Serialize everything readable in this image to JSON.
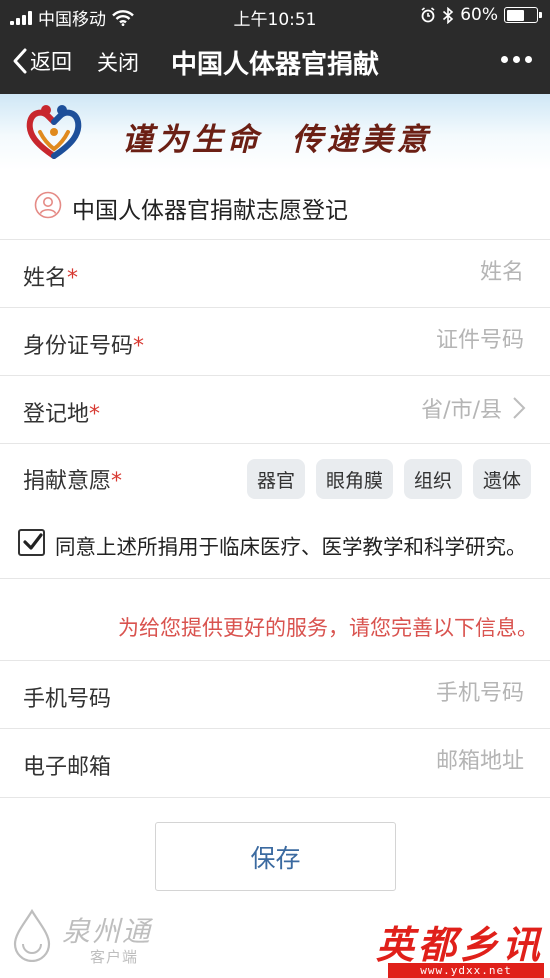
{
  "status_bar": {
    "carrier": "中国移动",
    "time": "上午10:51",
    "battery": "60%",
    "battery_level": 0.6
  },
  "nav": {
    "back_label": "返回",
    "close_label": "关闭",
    "title": "中国人体器官捐献"
  },
  "banner": {
    "slogan": "谨为生命  传递美意"
  },
  "section": {
    "title": "中国人体器官捐献志愿登记"
  },
  "form": {
    "name": {
      "label": "姓名",
      "required_mark": "*",
      "placeholder": "姓名",
      "value": ""
    },
    "id_number": {
      "label": "身份证号码",
      "required_mark": "*",
      "placeholder": "证件号码",
      "value": ""
    },
    "region": {
      "label": "登记地",
      "required_mark": "*",
      "placeholder": "省/市/县"
    },
    "intent": {
      "label": "捐献意愿",
      "required_mark": "*",
      "options": [
        "器官",
        "眼角膜",
        "组织",
        "遗体"
      ]
    },
    "agree": {
      "checked": true,
      "text": "同意上述所捐用于临床医疗、医学教学和科学研究。"
    },
    "notice": "为给您提供更好的服务，请您完善以下信息。",
    "phone": {
      "label": "手机号码",
      "placeholder": "手机号码",
      "value": ""
    },
    "email": {
      "label": "电子邮箱",
      "placeholder": "邮箱地址",
      "value": ""
    },
    "save_label": "保存"
  },
  "watermarks": {
    "left_name": "泉州通",
    "left_sub": "客户端",
    "right_name": "英都乡讯",
    "right_url": "www.ydxx.net"
  },
  "colors": {
    "bar_bg": "#2b2b2b",
    "required": "#d83a32",
    "notice": "#d9534f",
    "save_text": "#3b6aa0",
    "chip_bg": "#e9ecef"
  }
}
